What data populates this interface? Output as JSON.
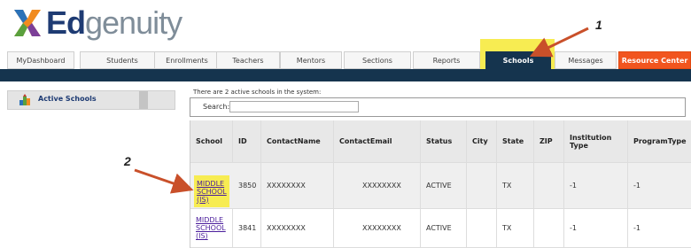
{
  "logo": {
    "brand_first": "Ed",
    "brand_second": "genuity"
  },
  "tabs": [
    {
      "label": "MyDashboard"
    },
    {
      "label": "Students"
    },
    {
      "label": "Enrollments"
    },
    {
      "label": "Teachers"
    },
    {
      "label": "Mentors"
    },
    {
      "label": "Sections"
    },
    {
      "label": "Reports"
    },
    {
      "label": "Schools"
    },
    {
      "label": "Messages"
    },
    {
      "label": "Resource Center"
    }
  ],
  "sidebar": {
    "label": "Active Schools"
  },
  "content": {
    "summary": "There are 2 active schools in the system:",
    "search_label": "Search:",
    "search_value": ""
  },
  "table": {
    "headers": [
      "School",
      "ID",
      "ContactName",
      "ContactEmail",
      "Status",
      "City",
      "State",
      "ZIP",
      "Institution Type",
      "ProgramType"
    ],
    "rows": [
      [
        "MIDDLE SCHOOL (IS)",
        "3850",
        "XXXXXXXX",
        "XXXXXXXX",
        "ACTIVE",
        "",
        "TX",
        "",
        "-1",
        "-1"
      ],
      [
        "MIDDLE SCHOOL (IS)",
        "3841",
        "XXXXXXXX",
        "XXXXXXXX",
        "ACTIVE",
        "",
        "TX",
        "",
        "-1",
        "-1"
      ]
    ]
  },
  "annotations": {
    "one": "1",
    "two": "2"
  },
  "colors": {
    "navy": "#15344e",
    "orange": "#f1551f",
    "highlight": "#f7ec52",
    "arrow": "#c9502a"
  }
}
